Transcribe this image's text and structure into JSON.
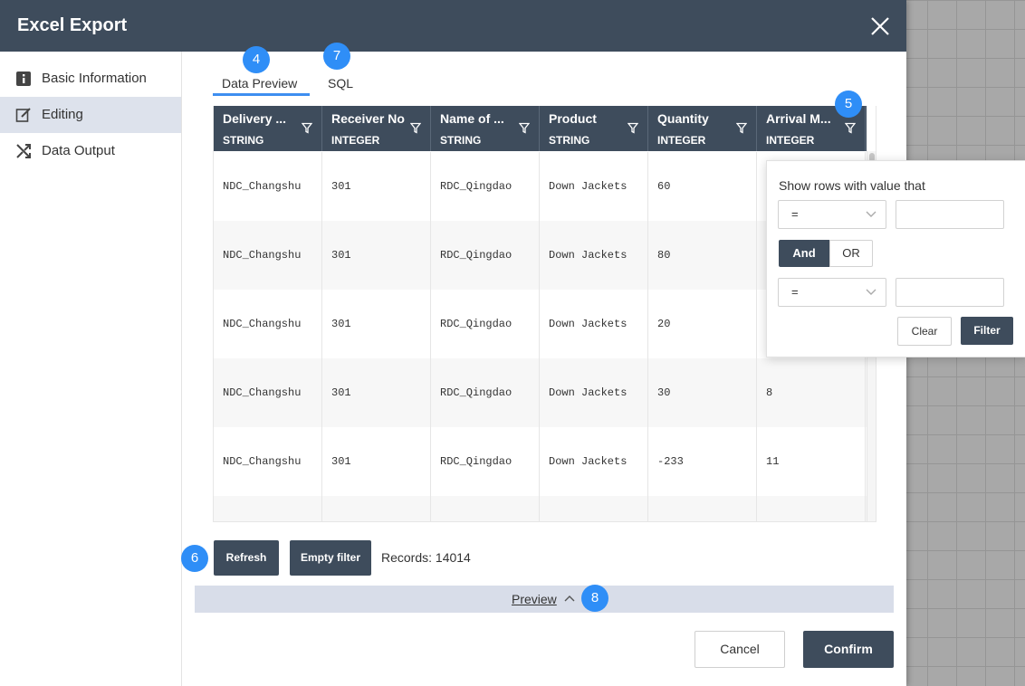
{
  "dialog": {
    "title": "Excel Export"
  },
  "sidebar": {
    "items": [
      {
        "label": "Basic Information",
        "icon": "info-icon",
        "active": false
      },
      {
        "label": "Editing",
        "icon": "edit-icon",
        "active": true
      },
      {
        "label": "Data Output",
        "icon": "shuffle-icon",
        "active": false
      }
    ]
  },
  "tabs": [
    {
      "label": "Data Preview",
      "active": true
    },
    {
      "label": "SQL",
      "active": false
    }
  ],
  "badges": {
    "data_preview": "4",
    "sql": "7",
    "filter": "5",
    "refresh": "6",
    "preview": "8"
  },
  "table": {
    "columns": [
      {
        "name": "Delivery ...",
        "type": "STRING"
      },
      {
        "name": "Receiver No",
        "type": "INTEGER"
      },
      {
        "name": "Name of ...",
        "type": "STRING"
      },
      {
        "name": "Product",
        "type": "STRING"
      },
      {
        "name": "Quantity",
        "type": "INTEGER"
      },
      {
        "name": "Arrival M...",
        "type": "INTEGER"
      }
    ],
    "rows": [
      [
        "NDC_Changshu",
        "301",
        "RDC_Qingdao",
        "Down Jackets",
        "60",
        ""
      ],
      [
        "NDC_Changshu",
        "301",
        "RDC_Qingdao",
        "Down Jackets",
        "80",
        ""
      ],
      [
        "NDC_Changshu",
        "301",
        "RDC_Qingdao",
        "Down Jackets",
        "20",
        ""
      ],
      [
        "NDC_Changshu",
        "301",
        "RDC_Qingdao",
        "Down Jackets",
        "30",
        "8"
      ],
      [
        "NDC_Changshu",
        "301",
        "RDC_Qingdao",
        "Down Jackets",
        "-233",
        "11"
      ],
      [
        "",
        "",
        "",
        "",
        "",
        ""
      ]
    ]
  },
  "filter_popup": {
    "title": "Show rows with value that",
    "condition1": {
      "operator": "=",
      "value": ""
    },
    "condition2": {
      "operator": "=",
      "value": ""
    },
    "logic": {
      "and_label": "And",
      "or_label": "OR",
      "selected": "And"
    },
    "clear_label": "Clear",
    "filter_label": "Filter"
  },
  "toolbar": {
    "refresh_label": "Refresh",
    "empty_filter_label": "Empty filter",
    "records_text": "Records: 14014"
  },
  "preview_bar": {
    "label": "Preview"
  },
  "footer": {
    "cancel_label": "Cancel",
    "confirm_label": "Confirm"
  },
  "colors": {
    "header": "#3e4c5c",
    "accent": "#2f8ef7",
    "active_nav": "#dde2ec",
    "preview_bar": "#d8dde9"
  }
}
